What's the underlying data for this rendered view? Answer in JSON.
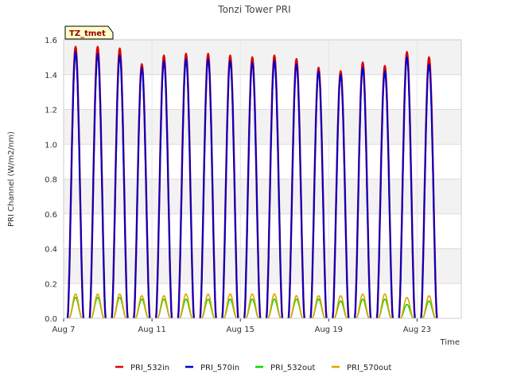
{
  "chart_data": {
    "type": "line",
    "title": "Tonzi Tower PRI",
    "xlabel": "Time",
    "ylabel": "PRI Channel (W/m2/nm)",
    "badge": "TZ_tmet",
    "ylim": [
      0,
      1.6
    ],
    "xlim": [
      7,
      25
    ],
    "yticks": [
      "0.0",
      "0.2",
      "0.4",
      "0.6",
      "0.8",
      "1.0",
      "1.2",
      "1.4",
      "1.6"
    ],
    "xticks": [
      {
        "value": 7,
        "label": "Aug 7"
      },
      {
        "value": 11,
        "label": "Aug 11"
      },
      {
        "value": 15,
        "label": "Aug 15"
      },
      {
        "value": 19,
        "label": "Aug 19"
      },
      {
        "value": 23,
        "label": "Aug 23"
      }
    ],
    "grid": true,
    "banded_background": true,
    "legend_position": "bottom",
    "day_peak_time": 0.54,
    "series": [
      {
        "name": "PRI_532in",
        "color": "#dd0000",
        "peaks": [
          1.56,
          1.56,
          1.55,
          1.46,
          1.51,
          1.52,
          1.52,
          1.51,
          1.5,
          1.51,
          1.49,
          1.44,
          1.42,
          1.47,
          1.45,
          1.53,
          1.5
        ]
      },
      {
        "name": "PRI_570in",
        "color": "#0000cc",
        "peaks": [
          1.53,
          1.52,
          1.51,
          1.44,
          1.48,
          1.49,
          1.49,
          1.48,
          1.47,
          1.48,
          1.46,
          1.42,
          1.4,
          1.44,
          1.42,
          1.5,
          1.46
        ]
      },
      {
        "name": "PRI_532out",
        "color": "#00dd00",
        "peaks": [
          0.12,
          0.12,
          0.12,
          0.11,
          0.11,
          0.11,
          0.11,
          0.11,
          0.11,
          0.11,
          0.11,
          0.11,
          0.1,
          0.11,
          0.11,
          0.08,
          0.1
        ]
      },
      {
        "name": "PRI_570out",
        "color": "#e6a000",
        "peaks": [
          0.14,
          0.14,
          0.14,
          0.13,
          0.13,
          0.14,
          0.14,
          0.14,
          0.14,
          0.14,
          0.13,
          0.13,
          0.13,
          0.14,
          0.14,
          0.12,
          0.13
        ]
      }
    ],
    "day_starts": [
      7,
      8,
      9,
      10,
      11,
      12,
      13,
      14,
      15,
      16,
      17,
      18,
      19,
      20,
      21,
      22,
      23
    ]
  }
}
